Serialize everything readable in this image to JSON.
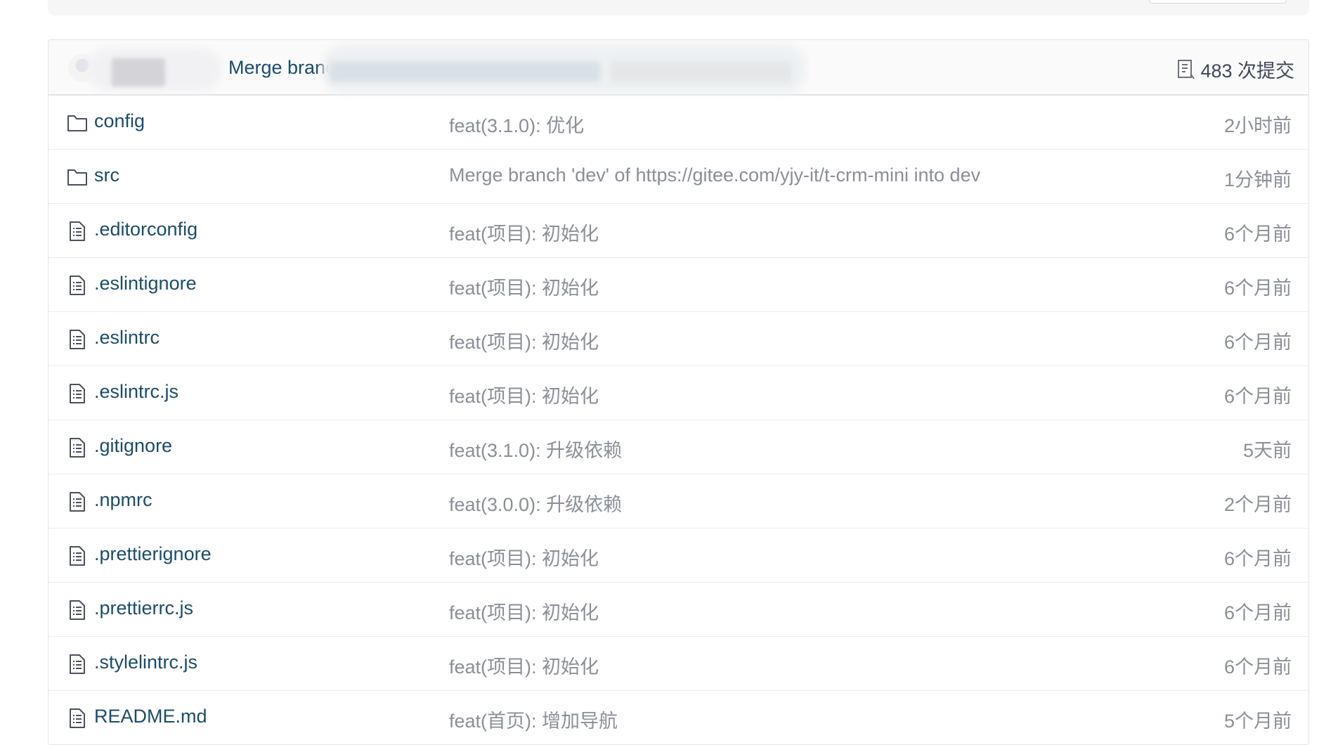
{
  "latest_commit": {
    "message": "Merge branch 'c",
    "count_label": "483 次提交"
  },
  "icons": {
    "folder": "folder-icon",
    "file": "file-icon",
    "commits": "commit-log-icon"
  },
  "colors": {
    "link": "#1b4d6b",
    "muted": "#8a8f99",
    "border": "#e3e3e3",
    "header_bg": "#fafafa"
  },
  "files": [
    {
      "type": "folder",
      "name": "config",
      "commit": "feat(3.1.0): 优化",
      "time": "2小时前"
    },
    {
      "type": "folder",
      "name": "src",
      "commit": "Merge branch 'dev' of https://gitee.com/yjy-it/t-crm-mini into dev",
      "time": "1分钟前"
    },
    {
      "type": "file",
      "name": ".editorconfig",
      "commit": "feat(项目): 初始化",
      "time": "6个月前"
    },
    {
      "type": "file",
      "name": ".eslintignore",
      "commit": "feat(项目): 初始化",
      "time": "6个月前"
    },
    {
      "type": "file",
      "name": ".eslintrc",
      "commit": "feat(项目): 初始化",
      "time": "6个月前"
    },
    {
      "type": "file",
      "name": ".eslintrc.js",
      "commit": "feat(项目): 初始化",
      "time": "6个月前"
    },
    {
      "type": "file",
      "name": ".gitignore",
      "commit": "feat(3.1.0): 升级依赖",
      "time": "5天前"
    },
    {
      "type": "file",
      "name": ".npmrc",
      "commit": "feat(3.0.0): 升级依赖",
      "time": "2个月前"
    },
    {
      "type": "file",
      "name": ".prettierignore",
      "commit": "feat(项目): 初始化",
      "time": "6个月前"
    },
    {
      "type": "file",
      "name": ".prettierrc.js",
      "commit": "feat(项目): 初始化",
      "time": "6个月前"
    },
    {
      "type": "file",
      "name": ".stylelintrc.js",
      "commit": "feat(项目): 初始化",
      "time": "6个月前"
    },
    {
      "type": "file",
      "name": "README.md",
      "commit": "feat(首页): 增加导航",
      "time": "5个月前"
    }
  ]
}
